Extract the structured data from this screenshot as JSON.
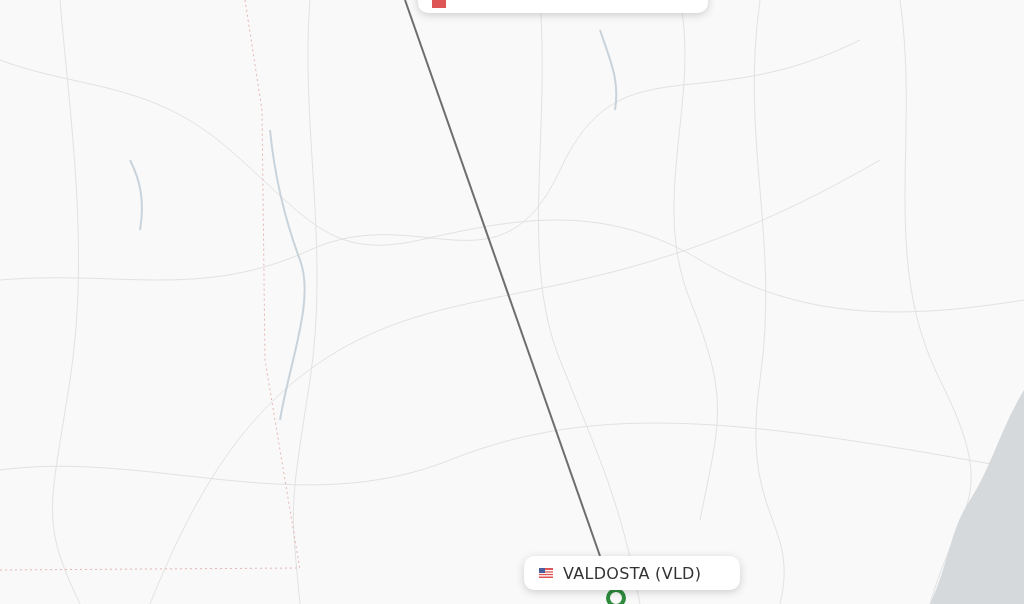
{
  "map": {
    "destination_label": "VALDOSTA (VLD)"
  }
}
